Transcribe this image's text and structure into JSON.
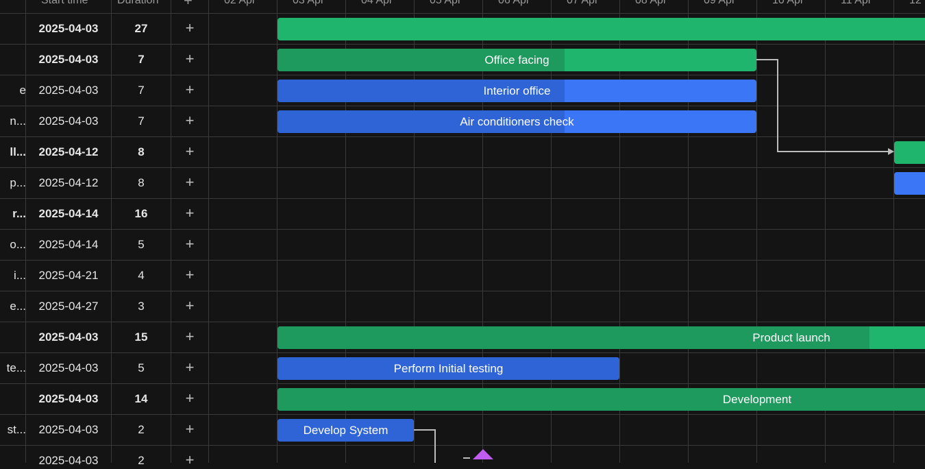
{
  "grid_header": {
    "start_time": "Start time",
    "duration": "Duration",
    "add": "+"
  },
  "timeline_dates": [
    "02 Apr",
    "03 Apr",
    "04 Apr",
    "05 Apr",
    "06 Apr",
    "07 Apr",
    "08 Apr",
    "09 Apr",
    "10 Apr",
    "11 Apr",
    "12"
  ],
  "rows": [
    {
      "name": "",
      "start": "2025-04-03",
      "duration": "27",
      "bold": true
    },
    {
      "name": "",
      "start": "2025-04-03",
      "duration": "7",
      "bold": true
    },
    {
      "name": "e",
      "start": "2025-04-03",
      "duration": "7",
      "bold": false
    },
    {
      "name": "n...",
      "start": "2025-04-03",
      "duration": "7",
      "bold": false
    },
    {
      "name": "ll...",
      "start": "2025-04-12",
      "duration": "8",
      "bold": true
    },
    {
      "name": "p...",
      "start": "2025-04-12",
      "duration": "8",
      "bold": false
    },
    {
      "name": "r...",
      "start": "2025-04-14",
      "duration": "16",
      "bold": true
    },
    {
      "name": "o...",
      "start": "2025-04-14",
      "duration": "5",
      "bold": false
    },
    {
      "name": "i...",
      "start": "2025-04-21",
      "duration": "4",
      "bold": false
    },
    {
      "name": "e...",
      "start": "2025-04-27",
      "duration": "3",
      "bold": false
    },
    {
      "name": "",
      "start": "2025-04-03",
      "duration": "15",
      "bold": true
    },
    {
      "name": "te...",
      "start": "2025-04-03",
      "duration": "5",
      "bold": false
    },
    {
      "name": "",
      "start": "2025-04-03",
      "duration": "14",
      "bold": true
    },
    {
      "name": "st...",
      "start": "2025-04-03",
      "duration": "2",
      "bold": false
    },
    {
      "name": "",
      "start": "2025-04-03",
      "duration": "2",
      "bold": false
    }
  ],
  "bars": [
    {
      "label": "",
      "color": "green",
      "progress": 0
    },
    {
      "label": "Office facing",
      "color": "green",
      "progress": 0.6
    },
    {
      "label": "Interior office",
      "color": "blue",
      "progress": 0.6
    },
    {
      "label": "Air conditioners check",
      "color": "blue",
      "progress": 0.6
    },
    {
      "label": "",
      "color": "green",
      "progress": 0
    },
    {
      "label": "",
      "color": "blue",
      "progress": 0
    },
    {
      "label": "Product launch",
      "color": "green",
      "progress": 0.9
    },
    {
      "label": "Perform Initial testing",
      "color": "blue",
      "progress": 1
    },
    {
      "label": "Development",
      "color": "green",
      "progress": 1
    },
    {
      "label": "Develop System",
      "color": "blue",
      "progress": 1
    }
  ],
  "colors": {
    "background": "#141414",
    "gridline": "#3a3a3a",
    "green": "#1fb56c",
    "green_done": "#1e9a5e",
    "blue": "#3b76f6",
    "blue_done": "#2f64d6",
    "milestone": "#c05cf0",
    "link": "#bdbdbd"
  }
}
